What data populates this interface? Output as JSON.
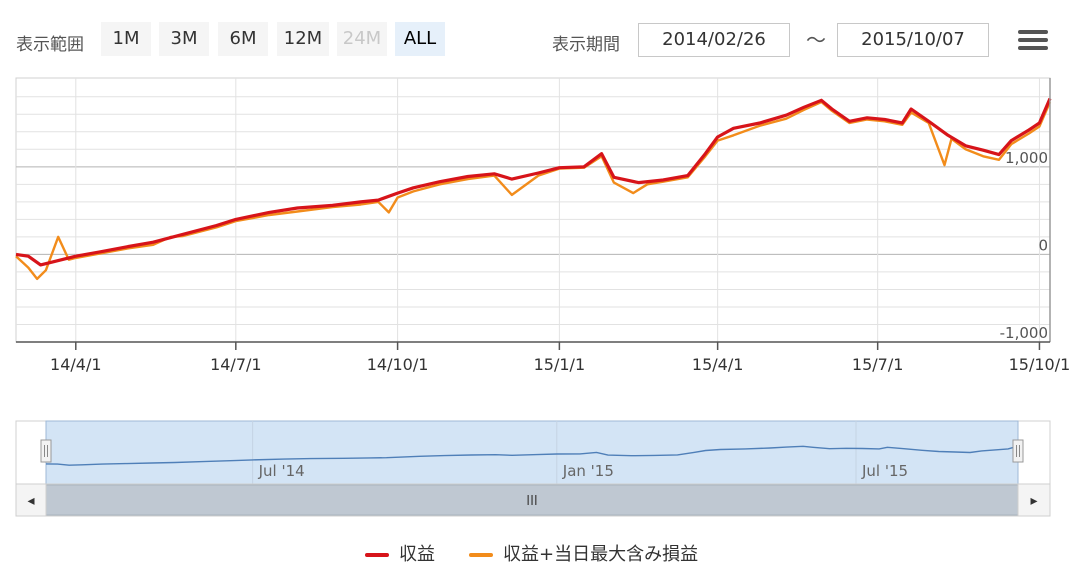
{
  "toolbar": {
    "range_label": "表示範囲",
    "range_buttons": [
      {
        "label": "1M",
        "state": "normal"
      },
      {
        "label": "3M",
        "state": "normal"
      },
      {
        "label": "6M",
        "state": "normal"
      },
      {
        "label": "12M",
        "state": "normal"
      },
      {
        "label": "24M",
        "state": "disabled"
      },
      {
        "label": "ALL",
        "state": "selected"
      }
    ],
    "period_label": "表示期間",
    "from_date": "2014/02/26",
    "separator": "〜",
    "to_date": "2015/10/07",
    "menu_icon": "hamburger-menu-icon"
  },
  "chart_data": {
    "type": "line",
    "title": "",
    "xlabel": "",
    "ylabel": "",
    "x_ticks": [
      "14/4/1",
      "14/7/1",
      "14/10/1",
      "15/1/1",
      "15/4/1",
      "15/7/1",
      "15/10/1"
    ],
    "x_tick_dates": [
      "2014-04-01",
      "2014-07-01",
      "2014-10-01",
      "2015-01-01",
      "2015-04-01",
      "2015-07-01",
      "2015-10-01"
    ],
    "xlim": [
      "2014-02-26",
      "2015-10-07"
    ],
    "y_ticks": [
      -1000,
      0,
      1000
    ],
    "y_tick_labels": [
      "-1,000",
      "0",
      "1,000"
    ],
    "ylim": [
      -1000,
      1900
    ],
    "grid": true,
    "legend_position": "bottom",
    "series": [
      {
        "name": "収益",
        "color": "#d7141a",
        "points": [
          [
            "2014-02-26",
            0
          ],
          [
            "2014-03-05",
            -20
          ],
          [
            "2014-03-12",
            -120
          ],
          [
            "2014-03-20",
            -80
          ],
          [
            "2014-04-01",
            -20
          ],
          [
            "2014-04-15",
            30
          ],
          [
            "2014-05-01",
            90
          ],
          [
            "2014-05-15",
            140
          ],
          [
            "2014-06-01",
            230
          ],
          [
            "2014-06-20",
            330
          ],
          [
            "2014-07-01",
            400
          ],
          [
            "2014-07-20",
            480
          ],
          [
            "2014-08-05",
            530
          ],
          [
            "2014-08-25",
            560
          ],
          [
            "2014-09-10",
            600
          ],
          [
            "2014-09-20",
            620
          ],
          [
            "2014-10-01",
            700
          ],
          [
            "2014-10-10",
            760
          ],
          [
            "2014-10-25",
            830
          ],
          [
            "2014-11-10",
            890
          ],
          [
            "2014-11-25",
            920
          ],
          [
            "2014-12-05",
            860
          ],
          [
            "2014-12-20",
            930
          ],
          [
            "2015-01-01",
            990
          ],
          [
            "2015-01-15",
            1000
          ],
          [
            "2015-01-25",
            1150
          ],
          [
            "2015-02-01",
            880
          ],
          [
            "2015-02-15",
            820
          ],
          [
            "2015-03-01",
            850
          ],
          [
            "2015-03-15",
            900
          ],
          [
            "2015-03-25",
            1150
          ],
          [
            "2015-04-01",
            1340
          ],
          [
            "2015-04-10",
            1440
          ],
          [
            "2015-04-25",
            1500
          ],
          [
            "2015-05-10",
            1590
          ],
          [
            "2015-05-20",
            1680
          ],
          [
            "2015-05-30",
            1760
          ],
          [
            "2015-06-05",
            1660
          ],
          [
            "2015-06-15",
            1520
          ],
          [
            "2015-06-25",
            1560
          ],
          [
            "2015-07-05",
            1540
          ],
          [
            "2015-07-15",
            1500
          ],
          [
            "2015-07-20",
            1660
          ],
          [
            "2015-07-30",
            1520
          ],
          [
            "2015-08-10",
            1360
          ],
          [
            "2015-08-20",
            1240
          ],
          [
            "2015-08-30",
            1190
          ],
          [
            "2015-09-08",
            1140
          ],
          [
            "2015-09-15",
            1300
          ],
          [
            "2015-09-25",
            1420
          ],
          [
            "2015-10-01",
            1500
          ],
          [
            "2015-10-07",
            1780
          ]
        ]
      },
      {
        "name": "収益+当日最大含み損益",
        "color": "#f28c1b",
        "points": [
          [
            "2014-02-26",
            -20
          ],
          [
            "2014-03-05",
            -150
          ],
          [
            "2014-03-10",
            -280
          ],
          [
            "2014-03-15",
            -180
          ],
          [
            "2014-03-22",
            200
          ],
          [
            "2014-03-28",
            -60
          ],
          [
            "2014-04-01",
            -40
          ],
          [
            "2014-04-15",
            10
          ],
          [
            "2014-05-01",
            70
          ],
          [
            "2014-05-15",
            110
          ],
          [
            "2014-05-25",
            200
          ],
          [
            "2014-06-01",
            210
          ],
          [
            "2014-06-20",
            310
          ],
          [
            "2014-07-01",
            380
          ],
          [
            "2014-07-20",
            450
          ],
          [
            "2014-08-05",
            490
          ],
          [
            "2014-08-25",
            540
          ],
          [
            "2014-09-10",
            570
          ],
          [
            "2014-09-20",
            600
          ],
          [
            "2014-09-26",
            480
          ],
          [
            "2014-10-01",
            650
          ],
          [
            "2014-10-10",
            720
          ],
          [
            "2014-10-25",
            800
          ],
          [
            "2014-11-10",
            860
          ],
          [
            "2014-11-25",
            900
          ],
          [
            "2014-12-05",
            680
          ],
          [
            "2014-12-20",
            900
          ],
          [
            "2015-01-01",
            980
          ],
          [
            "2015-01-15",
            990
          ],
          [
            "2015-01-25",
            1120
          ],
          [
            "2015-02-01",
            820
          ],
          [
            "2015-02-12",
            700
          ],
          [
            "2015-02-20",
            800
          ],
          [
            "2015-03-01",
            830
          ],
          [
            "2015-03-15",
            880
          ],
          [
            "2015-03-25",
            1120
          ],
          [
            "2015-04-01",
            1300
          ],
          [
            "2015-04-10",
            1360
          ],
          [
            "2015-04-25",
            1470
          ],
          [
            "2015-05-10",
            1550
          ],
          [
            "2015-05-20",
            1650
          ],
          [
            "2015-05-30",
            1740
          ],
          [
            "2015-06-05",
            1640
          ],
          [
            "2015-06-15",
            1500
          ],
          [
            "2015-06-25",
            1540
          ],
          [
            "2015-07-05",
            1520
          ],
          [
            "2015-07-15",
            1480
          ],
          [
            "2015-07-20",
            1620
          ],
          [
            "2015-07-30",
            1500
          ],
          [
            "2015-08-08",
            1020
          ],
          [
            "2015-08-12",
            1320
          ],
          [
            "2015-08-20",
            1200
          ],
          [
            "2015-08-30",
            1120
          ],
          [
            "2015-09-08",
            1080
          ],
          [
            "2015-09-15",
            1260
          ],
          [
            "2015-09-25",
            1380
          ],
          [
            "2015-10-01",
            1460
          ],
          [
            "2015-10-07",
            1740
          ]
        ]
      }
    ]
  },
  "navigator": {
    "labels": [
      "Jul '14",
      "Jan '15",
      "Jul '15"
    ],
    "label_dates": [
      "2014-07-01",
      "2015-01-01",
      "2015-07-01"
    ],
    "left_arrow": "◂",
    "right_arrow": "▸",
    "scroll_grip": "III",
    "handle_grip": "II"
  },
  "legend": {
    "items": [
      {
        "label": "収益",
        "color": "#d7141a"
      },
      {
        "label": "収益+当日最大含み損益",
        "color": "#f28c1b"
      }
    ]
  }
}
